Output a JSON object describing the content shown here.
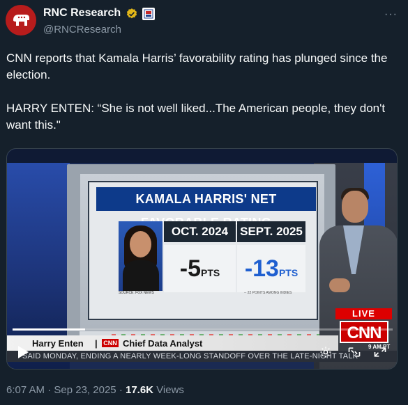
{
  "author": {
    "name": "RNC Research",
    "handle": "@RNCResearch",
    "verified_color": "#e2b719",
    "avatar_color": "#b71c1c"
  },
  "post": {
    "text": "CNN reports that Kamala Harris’ favorability rating has plunged since the election.\n\nHARRY ENTEN: “She is not well liked...The American people, they don't want this.\""
  },
  "video": {
    "chart_title": "KAMALA HARRIS' NET FAVORABLE RATING",
    "col_a_head": "OCT. 2024",
    "col_b_head": "SEPT. 2025",
    "col_a_value": "-5",
    "col_b_value": "-13",
    "pts_label": "PTS",
    "photo_caption": "SOURCE: FOX NEWS",
    "note": "-- 22 POINTS AMONG INDIES",
    "live_label": "LIVE",
    "network": "CNN",
    "time_bug": "9 AM PT",
    "lower_third_name": "Harry Enten",
    "lower_third_sep": "|",
    "lower_third_net": "CNN",
    "lower_third_title": "Chief Data Analyst",
    "ticker": "SAID MONDAY, ENDING A NEARLY WEEK-LONG STANDOFF OVER THE LATE-NIGHT TALK",
    "progress_fraction": 0.19
  },
  "meta": {
    "time": "6:07 AM",
    "sep1": "·",
    "date": "Sep 23, 2025",
    "sep2": "·",
    "views_count": "17.6K",
    "views_label": "Views"
  },
  "icons": [
    "rnc-logo-icon",
    "verified-badge-icon",
    "affiliate-badge-icon",
    "more-icon",
    "play-icon",
    "settings-icon",
    "pip-icon",
    "fullscreen-icon"
  ]
}
